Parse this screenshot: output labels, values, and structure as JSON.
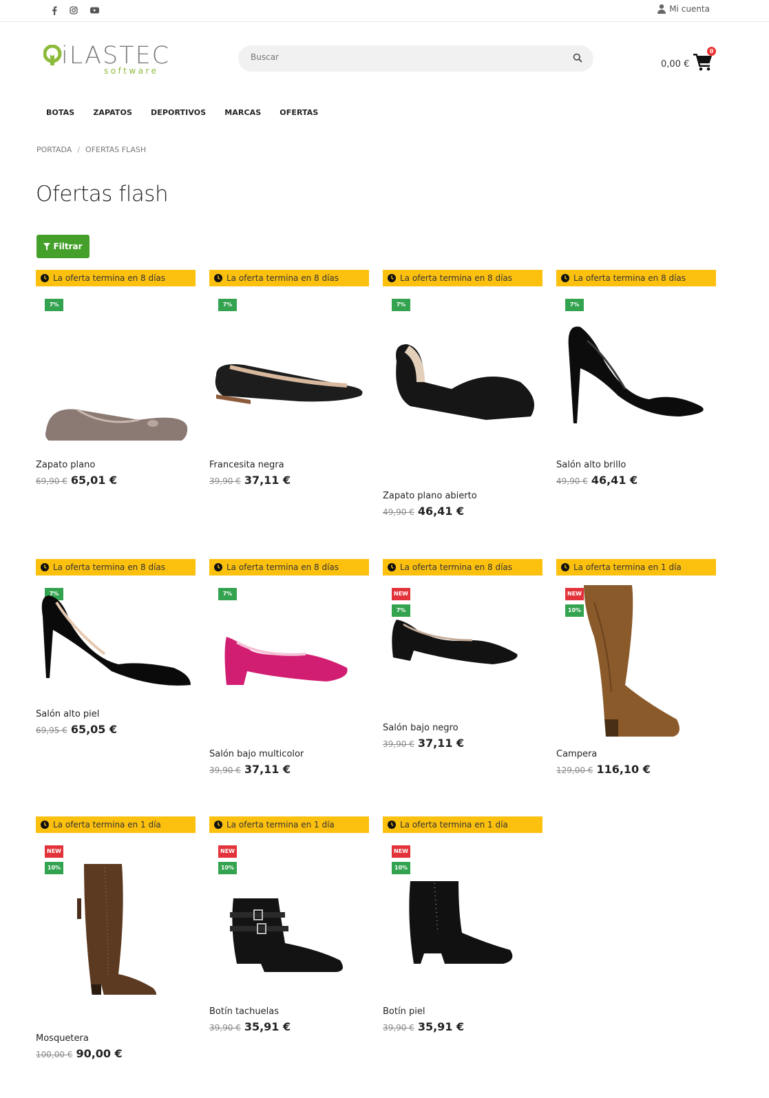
{
  "topbar": {
    "account_label": "Mi cuenta"
  },
  "header": {
    "logo_text": "iLASTEC",
    "logo_sub": "software",
    "search_placeholder": "Buscar",
    "cart_total": "0,00 €",
    "cart_count": "0"
  },
  "nav": [
    "BOTAS",
    "ZAPATOS",
    "DEPORTIVOS",
    "MARCAS",
    "OFERTAS"
  ],
  "breadcrumb": [
    "PORTADA",
    "OFERTAS FLASH"
  ],
  "page_title": "Ofertas flash",
  "filter_label": "Filtrar",
  "colors": {
    "accent_green": "#44a02a",
    "offer_yellow": "#fcc00f",
    "badge_new": "#e2323a",
    "badge_disc": "#33a350"
  },
  "products": [
    {
      "offer": "La oferta termina en 8 días",
      "badges": [
        "7%"
      ],
      "name": "Zapato plano",
      "old_price": "69,90 €",
      "price": "65,01 €",
      "image": "flat-shoe-metallic"
    },
    {
      "offer": "La oferta termina en 8 días",
      "badges": [
        "7%"
      ],
      "name": "Francesita negra",
      "old_price": "39,90 €",
      "price": "37,11 €",
      "image": "black-ballerina"
    },
    {
      "offer": "La oferta termina en 8 días",
      "badges": [
        "7%"
      ],
      "name": "Zapato plano abierto",
      "old_price": "49,90 €",
      "price": "46,41 €",
      "image": "black-dorsay-flat"
    },
    {
      "offer": "La oferta termina en 8 días",
      "badges": [
        "7%"
      ],
      "name": "Salón alto brillo",
      "old_price": "49,90 €",
      "price": "46,41 €",
      "image": "black-patent-pump"
    },
    {
      "offer": "La oferta termina en 8 días",
      "badges": [
        "7%"
      ],
      "name": "Salón alto piel",
      "old_price": "69,95 €",
      "price": "65,05 €",
      "image": "black-suede-pump"
    },
    {
      "offer": "La oferta termina en 8 días",
      "badges": [
        "7%"
      ],
      "name": "Salón bajo multicolor",
      "old_price": "39,90 €",
      "price": "37,11 €",
      "image": "pink-block-heel"
    },
    {
      "offer": "La oferta termina en 8 días",
      "badges": [
        "NEW",
        "7%"
      ],
      "name": "Salón bajo negro",
      "old_price": "39,90 €",
      "price": "37,11 €",
      "image": "black-block-heel"
    },
    {
      "offer": "La oferta termina en 1 día",
      "badges": [
        "NEW",
        "10%"
      ],
      "name": "Campera",
      "old_price": "129,00 €",
      "price": "116,10 €",
      "image": "brown-suede-boot"
    },
    {
      "offer": "La oferta termina en 1 día",
      "badges": [
        "NEW",
        "10%"
      ],
      "name": "Mosquetera",
      "old_price": "100,00 €",
      "price": "90,00 €",
      "image": "brown-over-knee-boot"
    },
    {
      "offer": "La oferta termina en 1 día",
      "badges": [
        "NEW",
        "10%"
      ],
      "name": "Botín tachuelas",
      "old_price": "39,90 €",
      "price": "35,91 €",
      "image": "studded-ankle-boot"
    },
    {
      "offer": "La oferta termina en 1 día",
      "badges": [
        "NEW",
        "10%"
      ],
      "name": "Botín piel",
      "old_price": "39,90 €",
      "price": "35,91 €",
      "image": "black-ankle-boot"
    }
  ]
}
